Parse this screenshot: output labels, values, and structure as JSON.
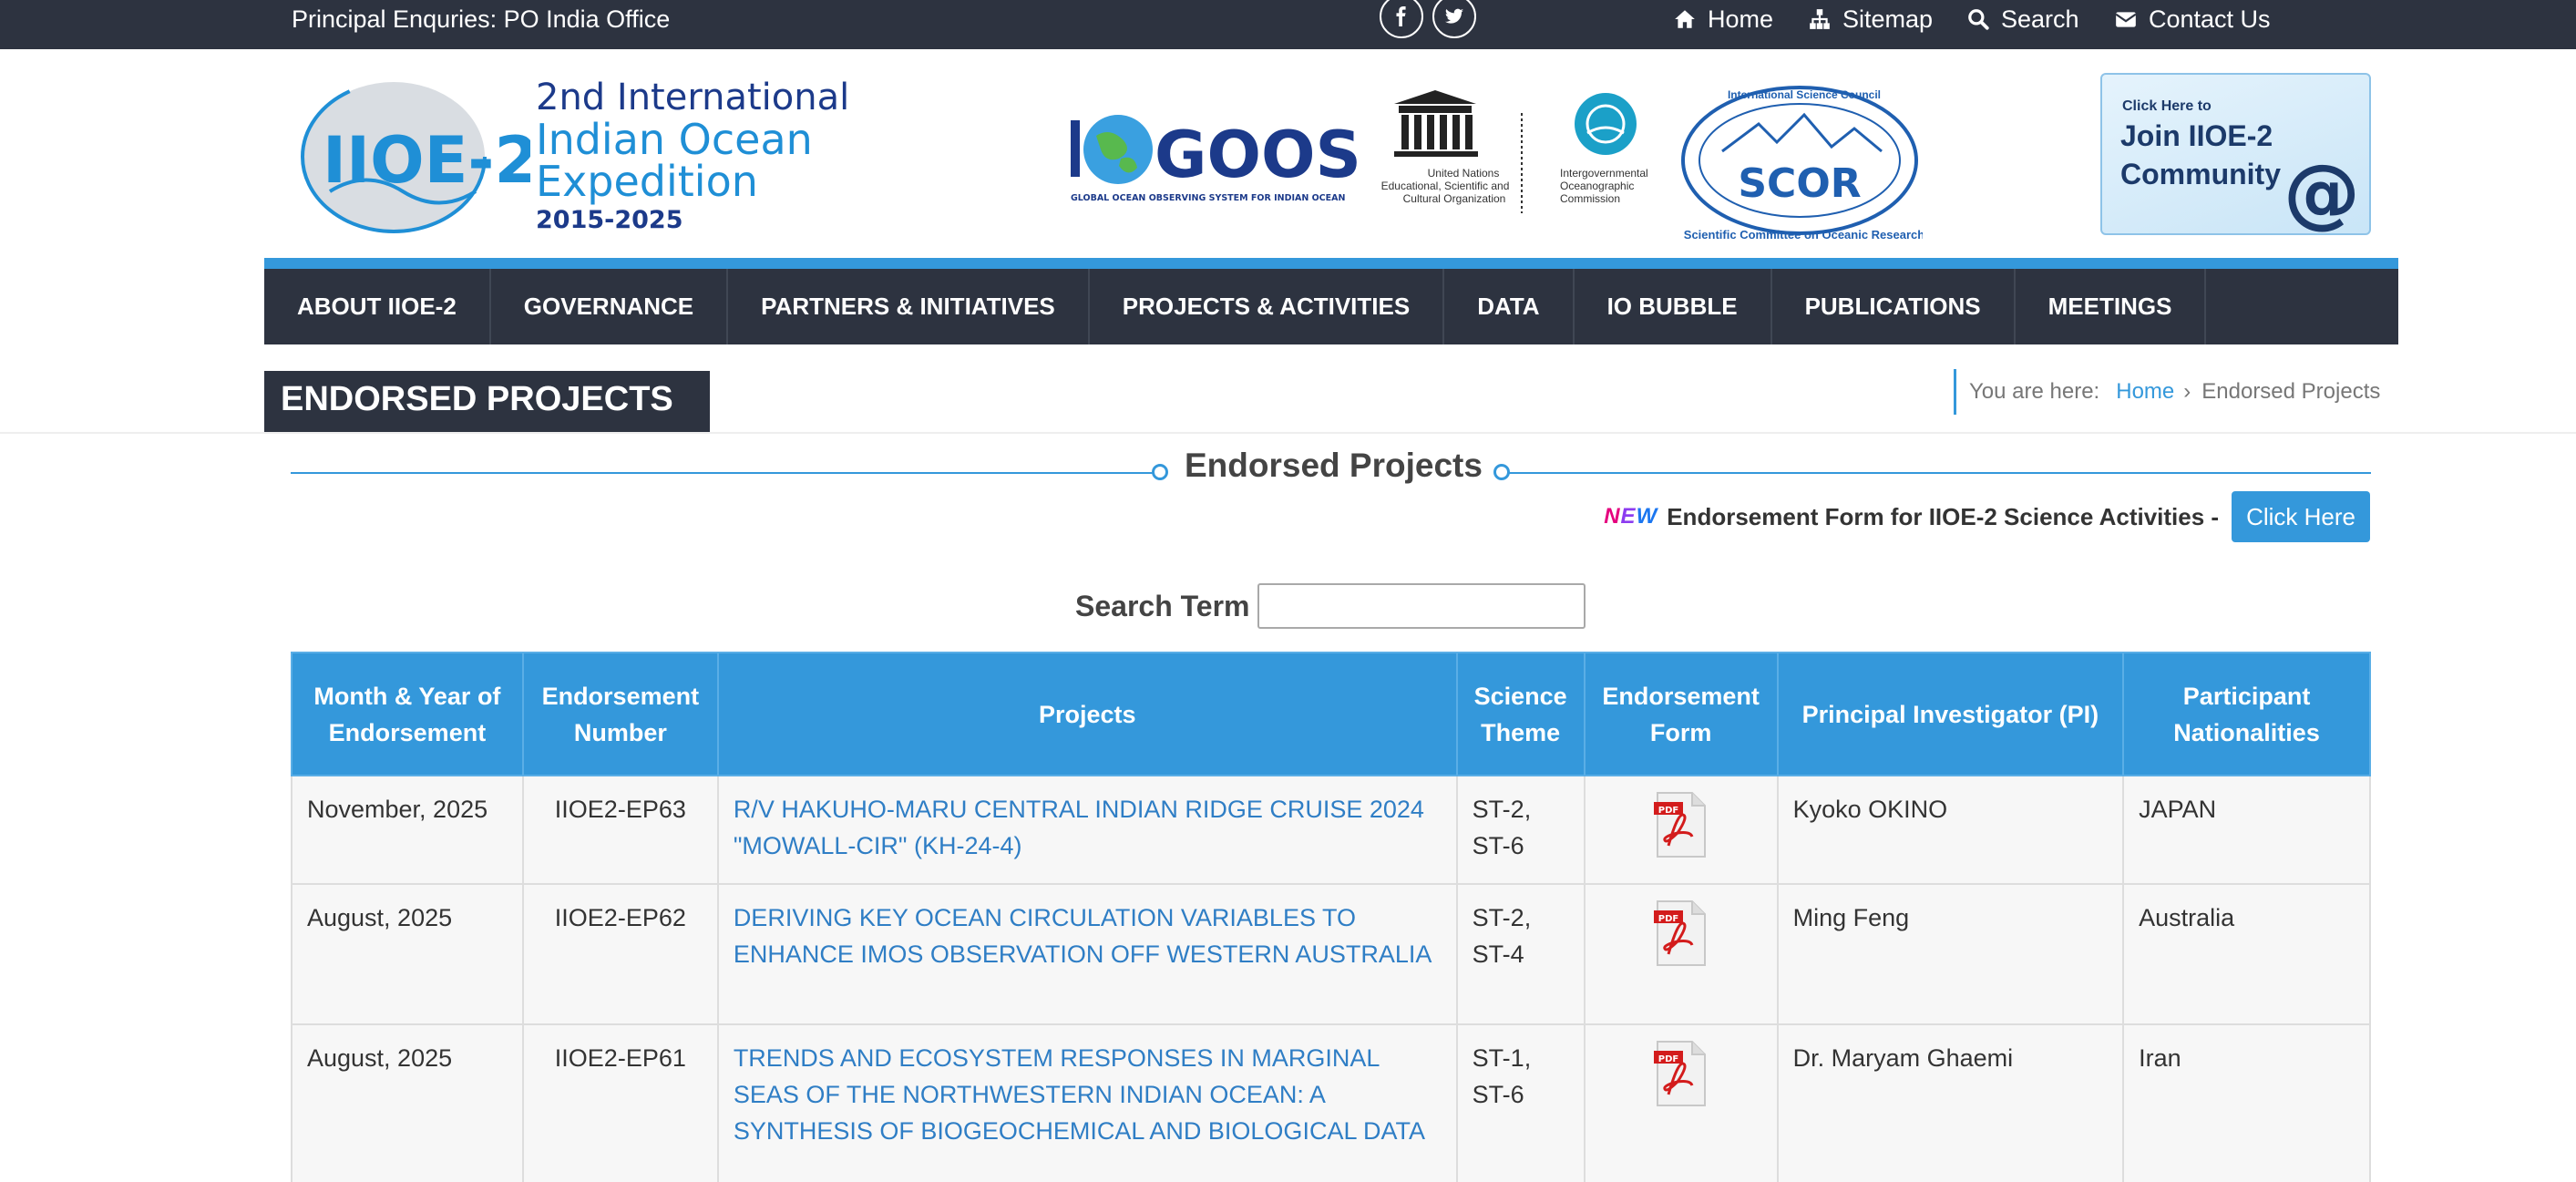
{
  "topbar": {
    "enquiries": "Principal Enquries: PO India Office",
    "social": [
      "facebook-icon",
      "twitter-icon"
    ],
    "links": [
      {
        "label": "Home",
        "icon": "home-icon"
      },
      {
        "label": "Sitemap",
        "icon": "sitemap-icon"
      },
      {
        "label": "Search",
        "icon": "search-icon"
      },
      {
        "label": "Contact Us",
        "icon": "envelope-icon"
      }
    ]
  },
  "header": {
    "logo_mark": "IIOE-2",
    "logo_line1": "2nd International",
    "logo_line2": "Indian Ocean",
    "logo_line3": "Expedition",
    "logo_years": "2015-2025",
    "iogoos": "IOGOOS",
    "iogoos_sub": "GLOBAL OCEAN OBSERVING SYSTEM FOR INDIAN OCEAN",
    "unesco_caption1": "United Nations",
    "unesco_caption2": "Educational, Scientific and",
    "unesco_caption3": "Cultural Organization",
    "ioc_caption1": "Intergovernmental",
    "ioc_caption2": "Oceanographic",
    "ioc_caption3": "Commission",
    "scor": "SCOR",
    "scor_arc_top": "International Science Council",
    "scor_arc_bottom": "Scientific Committee on Oceanic Research",
    "join_small": "Click Here to",
    "join_line1": "Join IIOE-2",
    "join_line2": "Community",
    "join_at": "@"
  },
  "nav": {
    "items": [
      "ABOUT IIOE-2",
      "GOVERNANCE",
      "PARTNERS & INITIATIVES",
      "PROJECTS & ACTIVITIES",
      "DATA",
      "IO BUBBLE",
      "PUBLICATIONS",
      "MEETINGS"
    ]
  },
  "page": {
    "title": "ENDORSED PROJECTS",
    "breadcrumb_prefix": "You are here:",
    "breadcrumb_home": "Home",
    "breadcrumb_sep": "›",
    "breadcrumb_current": "Endorsed Projects",
    "section_title": "Endorsed Projects",
    "new_badge": [
      "N",
      "E",
      "W"
    ],
    "endorsement_text": "Endorsement Form for IIOE-2 Science Activities -",
    "click_here": "Click Here",
    "search_label": "Search Term",
    "search_value": ""
  },
  "table": {
    "headers": [
      "Month & Year of Endorsement",
      "Endorsement Number",
      "Projects",
      "Science Theme",
      "Endorsement Form",
      "Principal Investigator (PI)",
      "Participant Nationalities"
    ],
    "rows": [
      {
        "date": "November, 2025",
        "number": "IIOE2-EP63",
        "project": "R/V HAKUHO-MARU CENTRAL INDIAN RIDGE CRUISE 2024 \"MOWALL-CIR\" (KH-24-4)",
        "theme": "ST-2, ST-6",
        "pi": "Kyoko OKINO",
        "nationality": "JAPAN"
      },
      {
        "date": "August, 2025",
        "number": "IIOE2-EP62",
        "project": "DERIVING KEY OCEAN CIRCULATION VARIABLES TO ENHANCE IMOS OBSERVATION OFF WESTERN AUSTRALIA",
        "theme": "ST-2, ST-4",
        "pi": "Ming Feng",
        "nationality": "Australia"
      },
      {
        "date": "August, 2025",
        "number": "IIOE2-EP61",
        "project": "TRENDS AND ECOSYSTEM RESPONSES IN MARGINAL SEAS OF THE NORTHWESTERN INDIAN OCEAN: A SYNTHESIS OF BIOGEOCHEMICAL AND BIOLOGICAL DATA",
        "theme": "ST-1, ST-6",
        "pi": "Dr. Maryam Ghaemi",
        "nationality": "Iran"
      }
    ]
  },
  "colors": {
    "dark": "#2d3340",
    "accent": "#3498db",
    "link": "#2f7ec5"
  }
}
